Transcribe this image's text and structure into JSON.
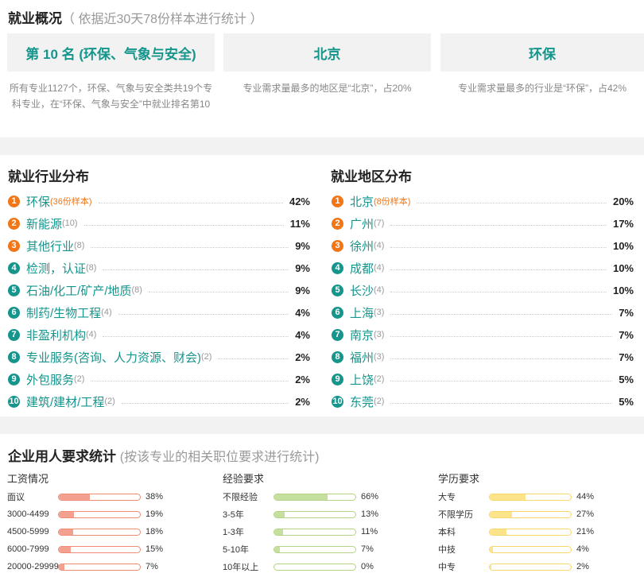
{
  "overview": {
    "title": "就业概况",
    "subtitle": "（ 依据近30天78份样本进行统计 ）",
    "cards": [
      {
        "label": "第 10 名 (环保、气象与安全)",
        "desc": "所有专业1127个，环保、气象与安全类共19个专科专业，在“环保、气象与安全”中就业排名第10"
      },
      {
        "label": "北京",
        "desc": "专业需求量最多的地区是“北京”，占20%"
      },
      {
        "label": "环保",
        "desc": "专业需求量最多的行业是“环保”，占42%"
      }
    ]
  },
  "industry": {
    "title": "就业行业分布",
    "items": [
      {
        "rank": "1",
        "name": "环保",
        "count": "(36份样本)",
        "pct": "42%"
      },
      {
        "rank": "2",
        "name": "新能源",
        "count": "(10)",
        "pct": "11%"
      },
      {
        "rank": "3",
        "name": "其他行业",
        "count": "(8)",
        "pct": "9%"
      },
      {
        "rank": "4",
        "name": "检测，认证",
        "count": "(8)",
        "pct": "9%"
      },
      {
        "rank": "5",
        "name": "石油/化工/矿产/地质",
        "count": "(8)",
        "pct": "9%"
      },
      {
        "rank": "6",
        "name": "制药/生物工程",
        "count": "(4)",
        "pct": "4%"
      },
      {
        "rank": "7",
        "name": "非盈利机构",
        "count": "(4)",
        "pct": "4%"
      },
      {
        "rank": "8",
        "name": "专业服务(咨询、人力资源、财会)",
        "count": "(2)",
        "pct": "2%"
      },
      {
        "rank": "9",
        "name": "外包服务",
        "count": "(2)",
        "pct": "2%"
      },
      {
        "rank": "10",
        "name": "建筑/建材/工程",
        "count": "(2)",
        "pct": "2%"
      }
    ]
  },
  "region": {
    "title": "就业地区分布",
    "items": [
      {
        "rank": "1",
        "name": "北京",
        "count": "(8份样本)",
        "pct": "20%"
      },
      {
        "rank": "2",
        "name": "广州",
        "count": "(7)",
        "pct": "17%"
      },
      {
        "rank": "3",
        "name": "徐州",
        "count": "(4)",
        "pct": "10%"
      },
      {
        "rank": "4",
        "name": "成都",
        "count": "(4)",
        "pct": "10%"
      },
      {
        "rank": "5",
        "name": "长沙",
        "count": "(4)",
        "pct": "10%"
      },
      {
        "rank": "6",
        "name": "上海",
        "count": "(3)",
        "pct": "7%"
      },
      {
        "rank": "7",
        "name": "南京",
        "count": "(3)",
        "pct": "7%"
      },
      {
        "rank": "8",
        "name": "福州",
        "count": "(3)",
        "pct": "7%"
      },
      {
        "rank": "9",
        "name": "上饶",
        "count": "(2)",
        "pct": "5%"
      },
      {
        "rank": "10",
        "name": "东莞",
        "count": "(2)",
        "pct": "5%"
      }
    ]
  },
  "requirements": {
    "title": "企业用人要求统计",
    "subtitle": "(按该专业的相关职位要求进行统计)",
    "columns": [
      {
        "title": "工资情况",
        "color": "#f4a08e",
        "border": "#f08b77",
        "rows": [
          {
            "label": "面议",
            "pct": "38%",
            "value": 38
          },
          {
            "label": "3000-4499",
            "pct": "19%",
            "value": 19
          },
          {
            "label": "4500-5999",
            "pct": "18%",
            "value": 18
          },
          {
            "label": "6000-7999",
            "pct": "15%",
            "value": 15
          },
          {
            "label": "20000-29999",
            "pct": "7%",
            "value": 7
          }
        ]
      },
      {
        "title": "经验要求",
        "color": "#c5df9e",
        "border": "#b3d488",
        "rows": [
          {
            "label": "不限经验",
            "pct": "66%",
            "value": 66
          },
          {
            "label": "3-5年",
            "pct": "13%",
            "value": 13
          },
          {
            "label": "1-3年",
            "pct": "11%",
            "value": 11
          },
          {
            "label": "5-10年",
            "pct": "7%",
            "value": 7
          },
          {
            "label": "10年以上",
            "pct": "0%",
            "value": 0
          }
        ]
      },
      {
        "title": "学历要求",
        "color": "#fde48a",
        "border": "#f8d868",
        "rows": [
          {
            "label": "大专",
            "pct": "44%",
            "value": 44
          },
          {
            "label": "不限学历",
            "pct": "27%",
            "value": 27
          },
          {
            "label": "本科",
            "pct": "21%",
            "value": 21
          },
          {
            "label": "中技",
            "pct": "4%",
            "value": 4
          },
          {
            "label": "中专",
            "pct": "2%",
            "value": 2
          }
        ]
      }
    ]
  }
}
